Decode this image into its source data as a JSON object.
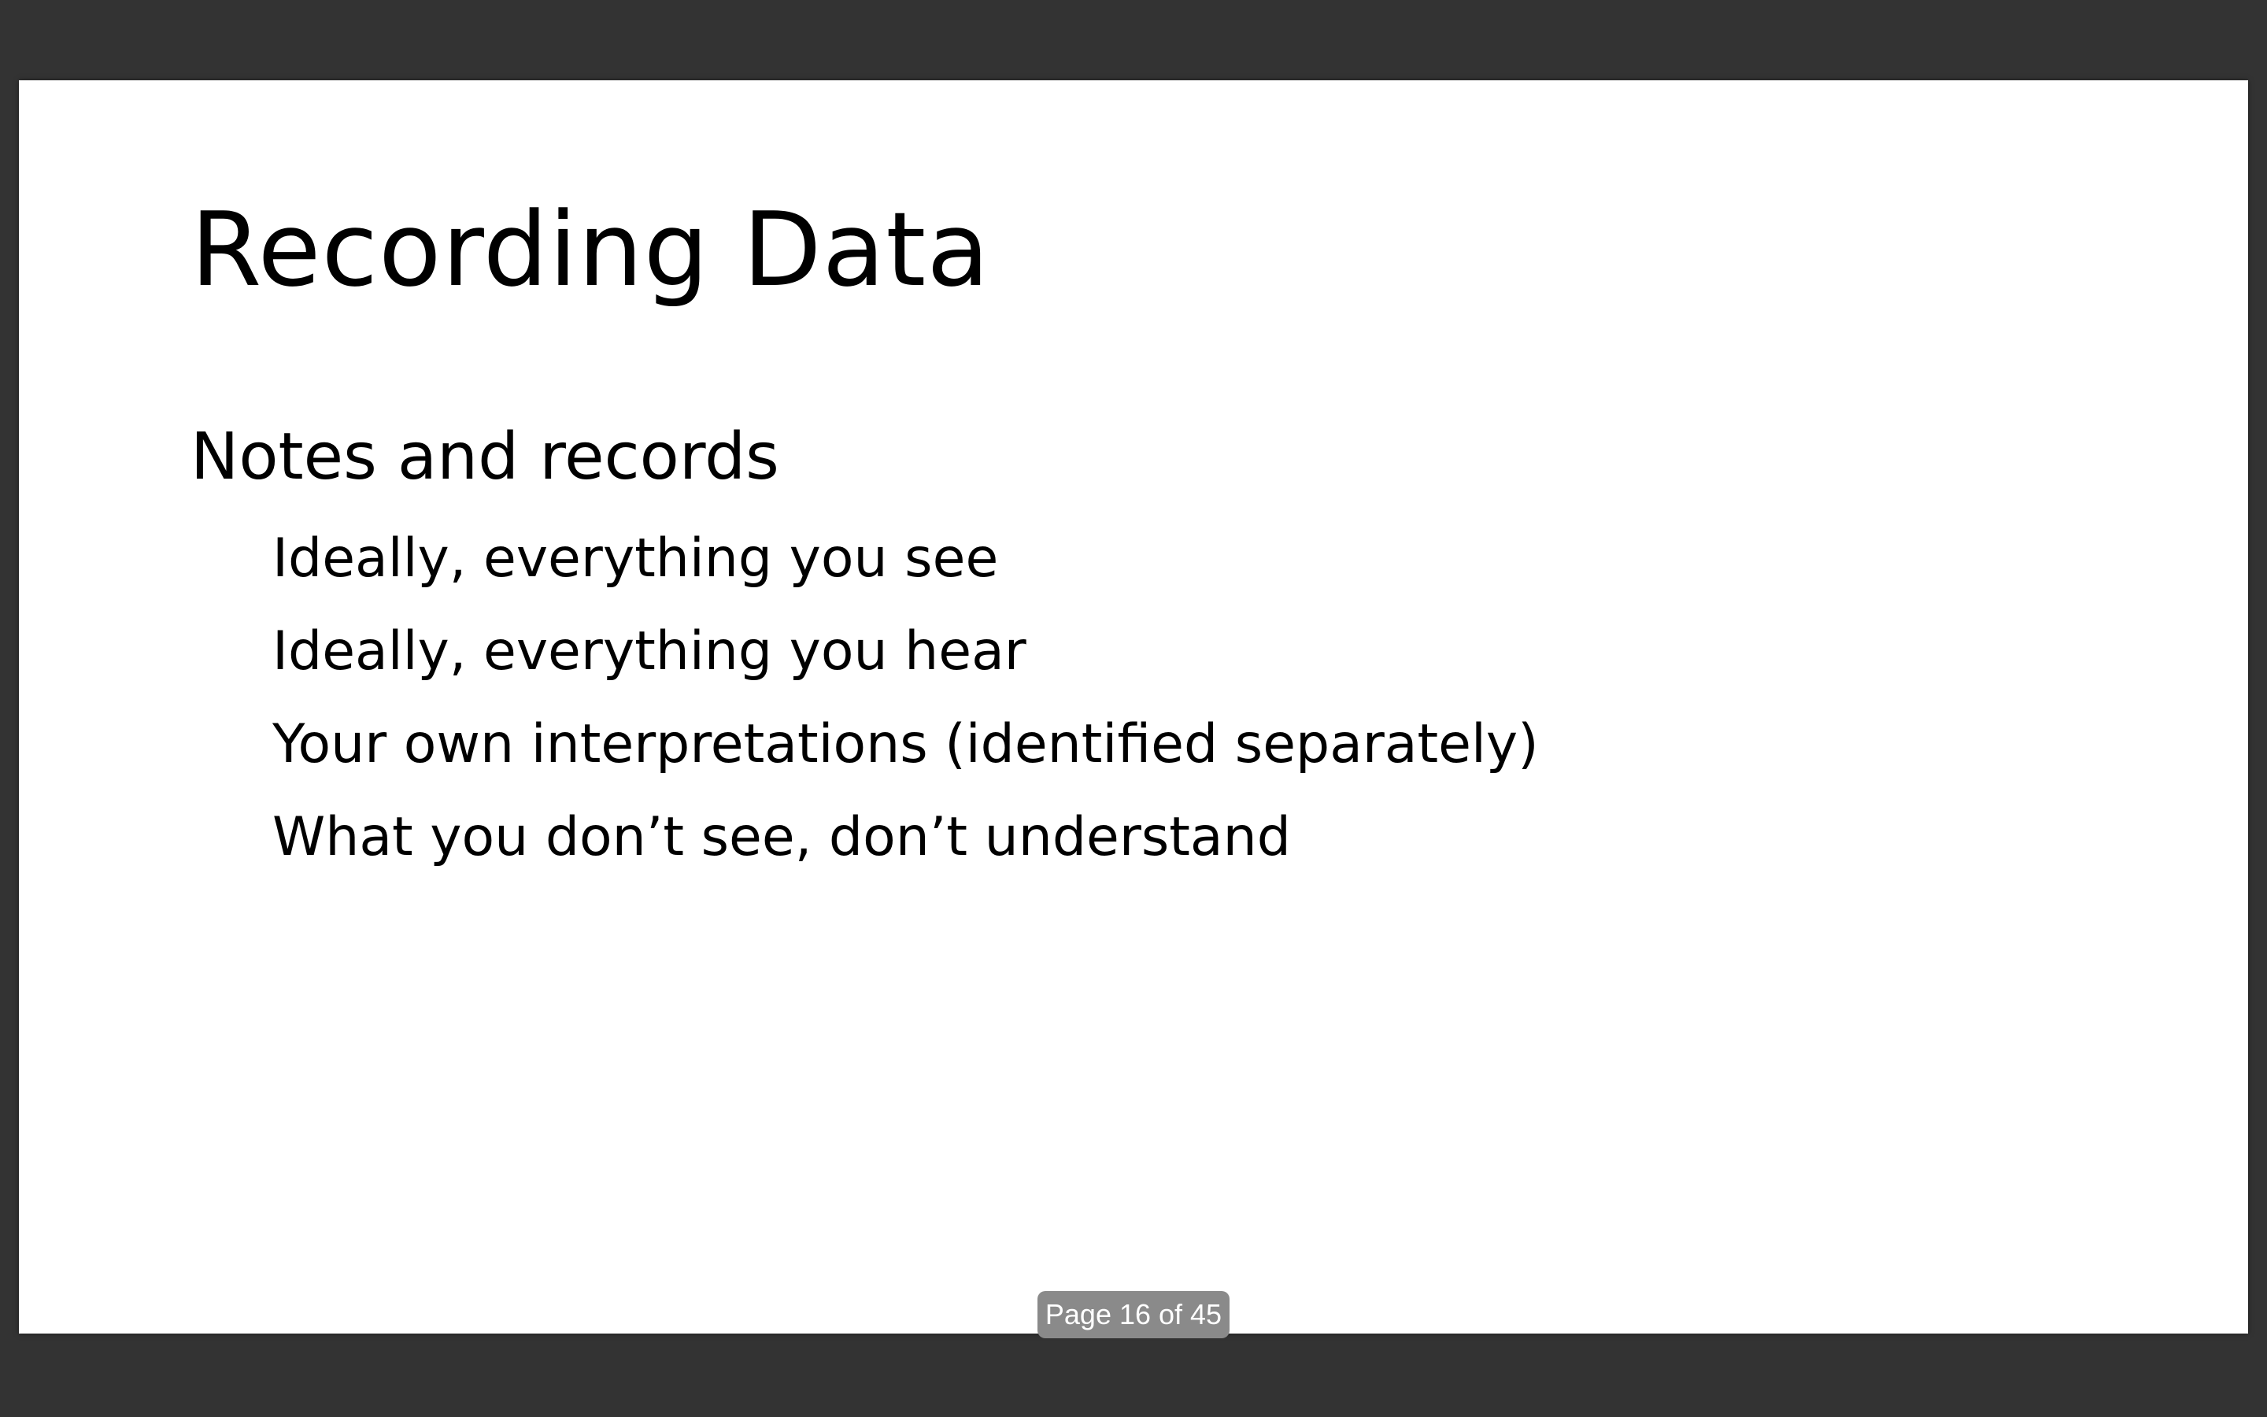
{
  "slide": {
    "title": "Recording Data",
    "heading": "Notes and records",
    "bullets": [
      "Ideally, everything you see",
      "Ideally, everything you hear",
      "Your own interpretations (identified separately)",
      "What you don’t see, don’t understand"
    ]
  },
  "viewer": {
    "page_indicator": "Page 16 of 45"
  },
  "colors": {
    "background": "#333333",
    "slide": "#ffffff",
    "text": "#000000",
    "indicator_bg": "#8a8a8a"
  }
}
